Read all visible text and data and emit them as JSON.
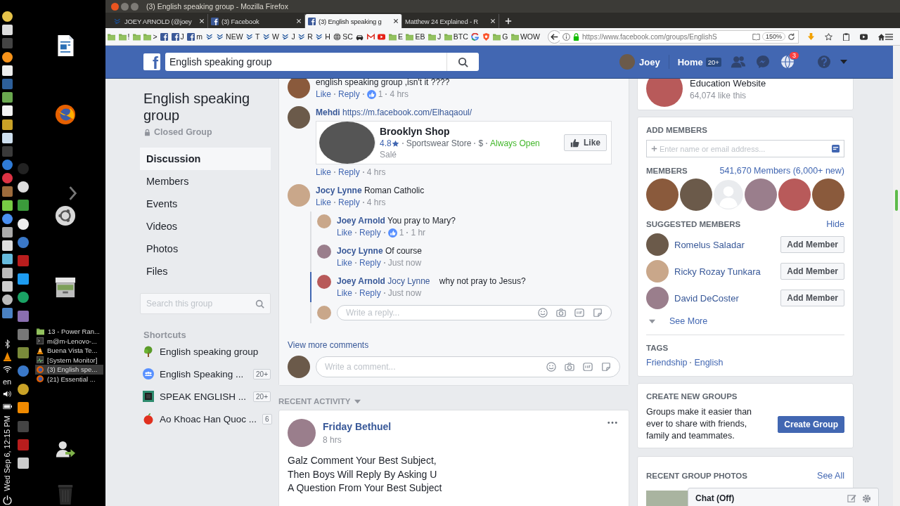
{
  "desktop": {
    "window_list": [
      {
        "label": "13 - Power Ran...",
        "kind": "folder",
        "selected": false
      },
      {
        "label": "m@m-Lenovo-...",
        "kind": "terminal",
        "selected": false
      },
      {
        "label": "Buena Vista Te...",
        "kind": "vlc",
        "selected": false
      },
      {
        "label": "[System Monitor]",
        "kind": "monitor",
        "selected": false
      },
      {
        "label": "(3) English spe...",
        "kind": "browser",
        "selected": true
      },
      {
        "label": "(21) Essential ...",
        "kind": "browser",
        "selected": false
      }
    ],
    "keyboard_layout": "en",
    "clock": "Wed Sep 6, 12:15 PM"
  },
  "browser": {
    "title": "(3) English speaking group - Mozilla Firefox",
    "tabs": [
      {
        "label": "JOEY ARNOLD (@joey",
        "kind": "steem",
        "selected": false
      },
      {
        "label": "(3) Facebook",
        "kind": "facebook",
        "selected": false
      },
      {
        "label": "(3) English speaking g",
        "kind": "facebook",
        "selected": true
      },
      {
        "label": "Matthew 24 Explained - R",
        "kind": "none",
        "selected": false
      }
    ],
    "bookmarks": [
      {
        "kind": "folder"
      },
      {
        "kind": "folder",
        "label": "!"
      },
      {
        "kind": "folder"
      },
      {
        "kind": "folder",
        "label": ">"
      },
      {
        "kind": "facebook"
      },
      {
        "kind": "facebook",
        "label": "J"
      },
      {
        "kind": "facebook",
        "label": "m"
      },
      {
        "kind": "steem"
      },
      {
        "kind": "steem",
        "label": "NEW"
      },
      {
        "kind": "steem",
        "label": "T"
      },
      {
        "kind": "steem",
        "label": "W"
      },
      {
        "kind": "steem",
        "label": "J"
      },
      {
        "kind": "steem",
        "label": "R"
      },
      {
        "kind": "steem",
        "label": "H"
      },
      {
        "kind": "globe",
        "label": "SC"
      },
      {
        "kind": "car"
      },
      {
        "kind": "mail"
      },
      {
        "kind": "video"
      },
      {
        "kind": "folder",
        "label": "E"
      },
      {
        "kind": "folder",
        "label": "EB"
      },
      {
        "kind": "folder",
        "label": "J"
      },
      {
        "kind": "folder",
        "label": "BTC"
      },
      {
        "kind": "google"
      },
      {
        "kind": "shield"
      },
      {
        "kind": "folder",
        "label": "G"
      },
      {
        "kind": "folder",
        "label": "WOW"
      }
    ],
    "url": "https://www.facebook.com/groups/EnglishS",
    "zoom": "150%"
  },
  "header": {
    "logo": "f",
    "search": {
      "value": "English speaking group"
    },
    "user": "Joey",
    "home": "Home",
    "home_badge": "20+",
    "notifications_badge": "3"
  },
  "group": {
    "title": "English speaking group",
    "privacy": "Closed Group",
    "nav": [
      {
        "label": "Discussion",
        "selected": true
      },
      {
        "label": "Members",
        "selected": false
      },
      {
        "label": "Events",
        "selected": false
      },
      {
        "label": "Videos",
        "selected": false
      },
      {
        "label": "Photos",
        "selected": false
      },
      {
        "label": "Files",
        "selected": false
      }
    ],
    "search": {
      "placeholder": "Search this group"
    },
    "shortcuts_title": "Shortcuts",
    "shortcuts": [
      {
        "label": "English speaking group",
        "kind": "tree"
      },
      {
        "label": "English Speaking ...",
        "kind": "group",
        "count": "20+"
      },
      {
        "label": "SPEAK ENGLISH ...",
        "kind": "square",
        "count": "20+"
      },
      {
        "label": "Ao Khoac Han Quoc ...",
        "kind": "apple",
        "count": "6"
      }
    ]
  },
  "comments": [
    {
      "text": "english speaking group ,isn't it ????",
      "actions": [
        "Like",
        "Reply"
      ],
      "reactions": "1",
      "time": "4 hrs"
    },
    {
      "author": "Mehdi",
      "link": "https://m.facebook.com/Elhaqaoul/",
      "attachment": {
        "name": "Brooklyn Shop",
        "rating": "4.8",
        "category": "Sportswear Store",
        "price": "$",
        "hours": "Always Open",
        "location": "Salé",
        "button": "Like"
      },
      "actions": [
        "Like",
        "Reply"
      ],
      "time": "4 hrs"
    },
    {
      "author": "Jocy Lynne",
      "text": "Roman Catholic",
      "actions": [
        "Like",
        "Reply"
      ],
      "time": "4 hrs",
      "replies": [
        {
          "author": "Joey Arnold",
          "text": "You pray to Mary?",
          "actions": [
            "Like",
            "Reply"
          ],
          "reactions": "1",
          "time": "1 hr",
          "highlighted": false
        },
        {
          "author": "Jocy Lynne",
          "text": "Of course",
          "actions": [
            "Like",
            "Reply"
          ],
          "time": "Just now",
          "highlighted": false
        },
        {
          "author": "Joey Arnold",
          "mention": "Jocy Lynne",
          "text": "why not pray to Jesus?",
          "actions": [
            "Like",
            "Reply"
          ],
          "time": "Just now",
          "highlighted": true
        }
      ],
      "reply_box": {
        "placeholder": "Write a reply..."
      }
    }
  ],
  "view_more": "View more comments",
  "comment_box": {
    "placeholder": "Write a comment..."
  },
  "recent_activity": "RECENT ACTIVITY",
  "post": {
    "author": "Friday Bethuel",
    "time": "8 hrs",
    "text": "Galz Comment Your Best Subject,\nThen Boys Will Reply By Asking U\nA Question From Your Best Subject"
  },
  "right": {
    "page": {
      "name": "Education Website",
      "likes": "64,074 like this"
    },
    "add_members": {
      "title": "ADD MEMBERS",
      "placeholder": "Enter name or email address..."
    },
    "members": {
      "title": "MEMBERS",
      "count": "541,670 Members (6,000+ new)",
      "avatars": [
        {
          "kind": "photo"
        },
        {
          "kind": "photo"
        },
        {
          "kind": "silhouette"
        },
        {
          "kind": "photo"
        },
        {
          "kind": "photo"
        },
        {
          "kind": "photo"
        }
      ]
    },
    "suggested": {
      "title": "SUGGESTED MEMBERS",
      "hide": "Hide",
      "people": [
        {
          "name": "Romelus Saladar",
          "button": "Add Member"
        },
        {
          "name": "Ricky Rozay Tunkara",
          "button": "Add Member"
        },
        {
          "name": "David DeCoster",
          "button": "Add Member"
        }
      ],
      "see_more": "See More"
    },
    "tags": {
      "title": "TAGS",
      "items": [
        "Friendship",
        "English"
      ]
    },
    "create": {
      "title": "CREATE NEW GROUPS",
      "text": "Groups make it easier than ever to share with friends, family and teammates.",
      "button": "Create Group"
    },
    "photos": {
      "title": "RECENT GROUP PHOTOS",
      "see_all": "See All"
    }
  },
  "chat": {
    "label": "Chat (Off)"
  }
}
